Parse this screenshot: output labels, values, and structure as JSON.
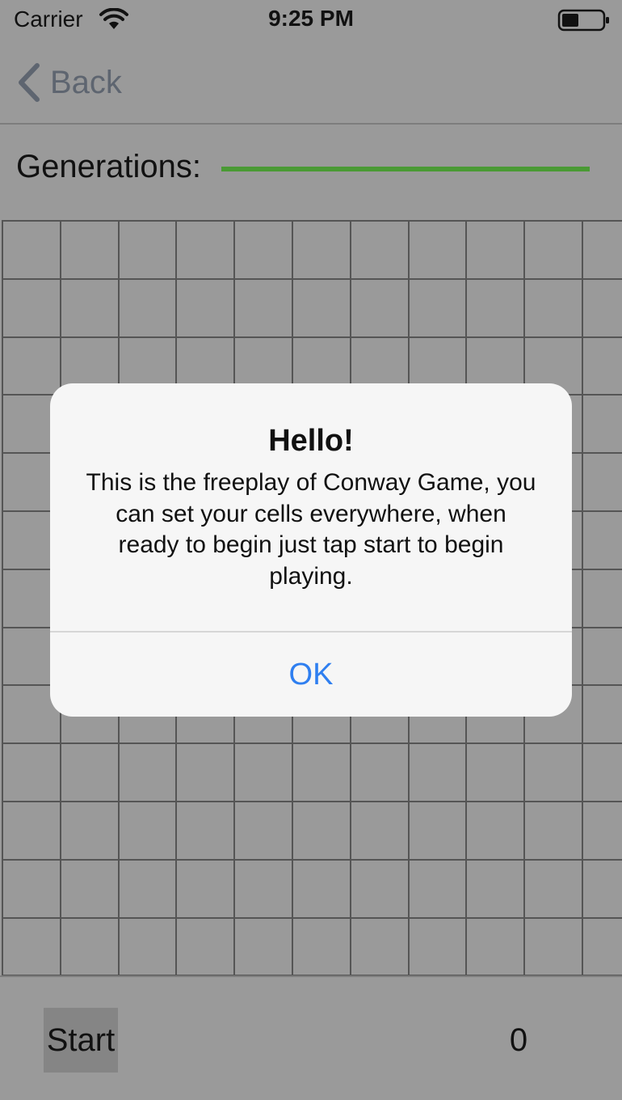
{
  "status_bar": {
    "carrier": "Carrier",
    "time": "9:25 PM",
    "wifi_icon": "wifi-icon",
    "battery_icon": "battery-icon"
  },
  "nav": {
    "back_label": "Back",
    "back_icon": "chevron-left-icon"
  },
  "generations": {
    "label": "Generations:",
    "progress": 1.0,
    "progress_color": "#4a9a34"
  },
  "board": {
    "columns": 11,
    "rows": 13,
    "line_color": "#555555"
  },
  "bottom": {
    "start_label": "Start",
    "count": "0"
  },
  "alert": {
    "title": "Hello!",
    "message": "This is the freeplay of Conway Game, you can set your cells everywhere, when ready to begin just tap start to begin playing.",
    "ok_label": "OK",
    "ok_color": "#2f7ff0"
  },
  "colors": {
    "background_dimmed": "#9a9a9a",
    "alert_background": "#f6f6f6"
  }
}
